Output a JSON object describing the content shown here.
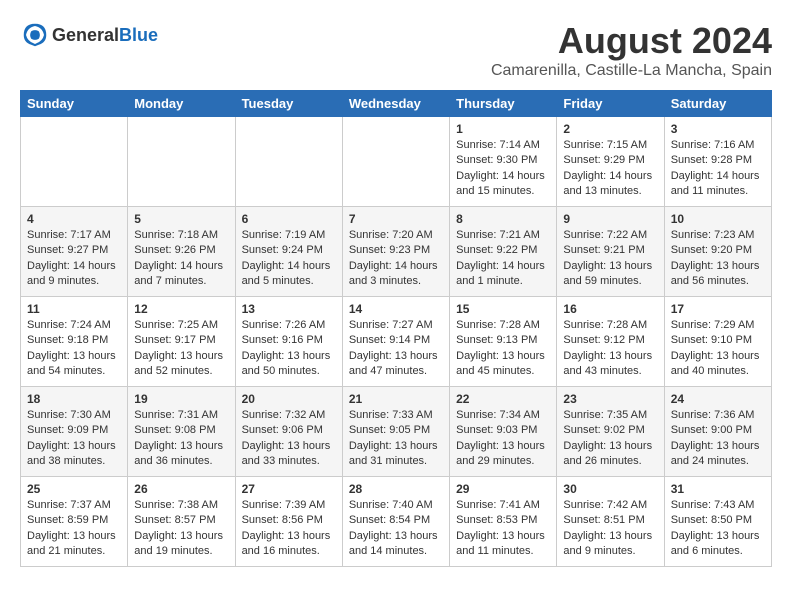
{
  "header": {
    "logo_general": "General",
    "logo_blue": "Blue",
    "month_year": "August 2024",
    "location": "Camarenilla, Castille-La Mancha, Spain"
  },
  "days_of_week": [
    "Sunday",
    "Monday",
    "Tuesday",
    "Wednesday",
    "Thursday",
    "Friday",
    "Saturday"
  ],
  "weeks": [
    [
      {
        "day": "",
        "content": ""
      },
      {
        "day": "",
        "content": ""
      },
      {
        "day": "",
        "content": ""
      },
      {
        "day": "",
        "content": ""
      },
      {
        "day": "1",
        "content": "Sunrise: 7:14 AM\nSunset: 9:30 PM\nDaylight: 14 hours\nand 15 minutes."
      },
      {
        "day": "2",
        "content": "Sunrise: 7:15 AM\nSunset: 9:29 PM\nDaylight: 14 hours\nand 13 minutes."
      },
      {
        "day": "3",
        "content": "Sunrise: 7:16 AM\nSunset: 9:28 PM\nDaylight: 14 hours\nand 11 minutes."
      }
    ],
    [
      {
        "day": "4",
        "content": "Sunrise: 7:17 AM\nSunset: 9:27 PM\nDaylight: 14 hours\nand 9 minutes."
      },
      {
        "day": "5",
        "content": "Sunrise: 7:18 AM\nSunset: 9:26 PM\nDaylight: 14 hours\nand 7 minutes."
      },
      {
        "day": "6",
        "content": "Sunrise: 7:19 AM\nSunset: 9:24 PM\nDaylight: 14 hours\nand 5 minutes."
      },
      {
        "day": "7",
        "content": "Sunrise: 7:20 AM\nSunset: 9:23 PM\nDaylight: 14 hours\nand 3 minutes."
      },
      {
        "day": "8",
        "content": "Sunrise: 7:21 AM\nSunset: 9:22 PM\nDaylight: 14 hours\nand 1 minute."
      },
      {
        "day": "9",
        "content": "Sunrise: 7:22 AM\nSunset: 9:21 PM\nDaylight: 13 hours\nand 59 minutes."
      },
      {
        "day": "10",
        "content": "Sunrise: 7:23 AM\nSunset: 9:20 PM\nDaylight: 13 hours\nand 56 minutes."
      }
    ],
    [
      {
        "day": "11",
        "content": "Sunrise: 7:24 AM\nSunset: 9:18 PM\nDaylight: 13 hours\nand 54 minutes."
      },
      {
        "day": "12",
        "content": "Sunrise: 7:25 AM\nSunset: 9:17 PM\nDaylight: 13 hours\nand 52 minutes."
      },
      {
        "day": "13",
        "content": "Sunrise: 7:26 AM\nSunset: 9:16 PM\nDaylight: 13 hours\nand 50 minutes."
      },
      {
        "day": "14",
        "content": "Sunrise: 7:27 AM\nSunset: 9:14 PM\nDaylight: 13 hours\nand 47 minutes."
      },
      {
        "day": "15",
        "content": "Sunrise: 7:28 AM\nSunset: 9:13 PM\nDaylight: 13 hours\nand 45 minutes."
      },
      {
        "day": "16",
        "content": "Sunrise: 7:28 AM\nSunset: 9:12 PM\nDaylight: 13 hours\nand 43 minutes."
      },
      {
        "day": "17",
        "content": "Sunrise: 7:29 AM\nSunset: 9:10 PM\nDaylight: 13 hours\nand 40 minutes."
      }
    ],
    [
      {
        "day": "18",
        "content": "Sunrise: 7:30 AM\nSunset: 9:09 PM\nDaylight: 13 hours\nand 38 minutes."
      },
      {
        "day": "19",
        "content": "Sunrise: 7:31 AM\nSunset: 9:08 PM\nDaylight: 13 hours\nand 36 minutes."
      },
      {
        "day": "20",
        "content": "Sunrise: 7:32 AM\nSunset: 9:06 PM\nDaylight: 13 hours\nand 33 minutes."
      },
      {
        "day": "21",
        "content": "Sunrise: 7:33 AM\nSunset: 9:05 PM\nDaylight: 13 hours\nand 31 minutes."
      },
      {
        "day": "22",
        "content": "Sunrise: 7:34 AM\nSunset: 9:03 PM\nDaylight: 13 hours\nand 29 minutes."
      },
      {
        "day": "23",
        "content": "Sunrise: 7:35 AM\nSunset: 9:02 PM\nDaylight: 13 hours\nand 26 minutes."
      },
      {
        "day": "24",
        "content": "Sunrise: 7:36 AM\nSunset: 9:00 PM\nDaylight: 13 hours\nand 24 minutes."
      }
    ],
    [
      {
        "day": "25",
        "content": "Sunrise: 7:37 AM\nSunset: 8:59 PM\nDaylight: 13 hours\nand 21 minutes."
      },
      {
        "day": "26",
        "content": "Sunrise: 7:38 AM\nSunset: 8:57 PM\nDaylight: 13 hours\nand 19 minutes."
      },
      {
        "day": "27",
        "content": "Sunrise: 7:39 AM\nSunset: 8:56 PM\nDaylight: 13 hours\nand 16 minutes."
      },
      {
        "day": "28",
        "content": "Sunrise: 7:40 AM\nSunset: 8:54 PM\nDaylight: 13 hours\nand 14 minutes."
      },
      {
        "day": "29",
        "content": "Sunrise: 7:41 AM\nSunset: 8:53 PM\nDaylight: 13 hours\nand 11 minutes."
      },
      {
        "day": "30",
        "content": "Sunrise: 7:42 AM\nSunset: 8:51 PM\nDaylight: 13 hours\nand 9 minutes."
      },
      {
        "day": "31",
        "content": "Sunrise: 7:43 AM\nSunset: 8:50 PM\nDaylight: 13 hours\nand 6 minutes."
      }
    ]
  ]
}
